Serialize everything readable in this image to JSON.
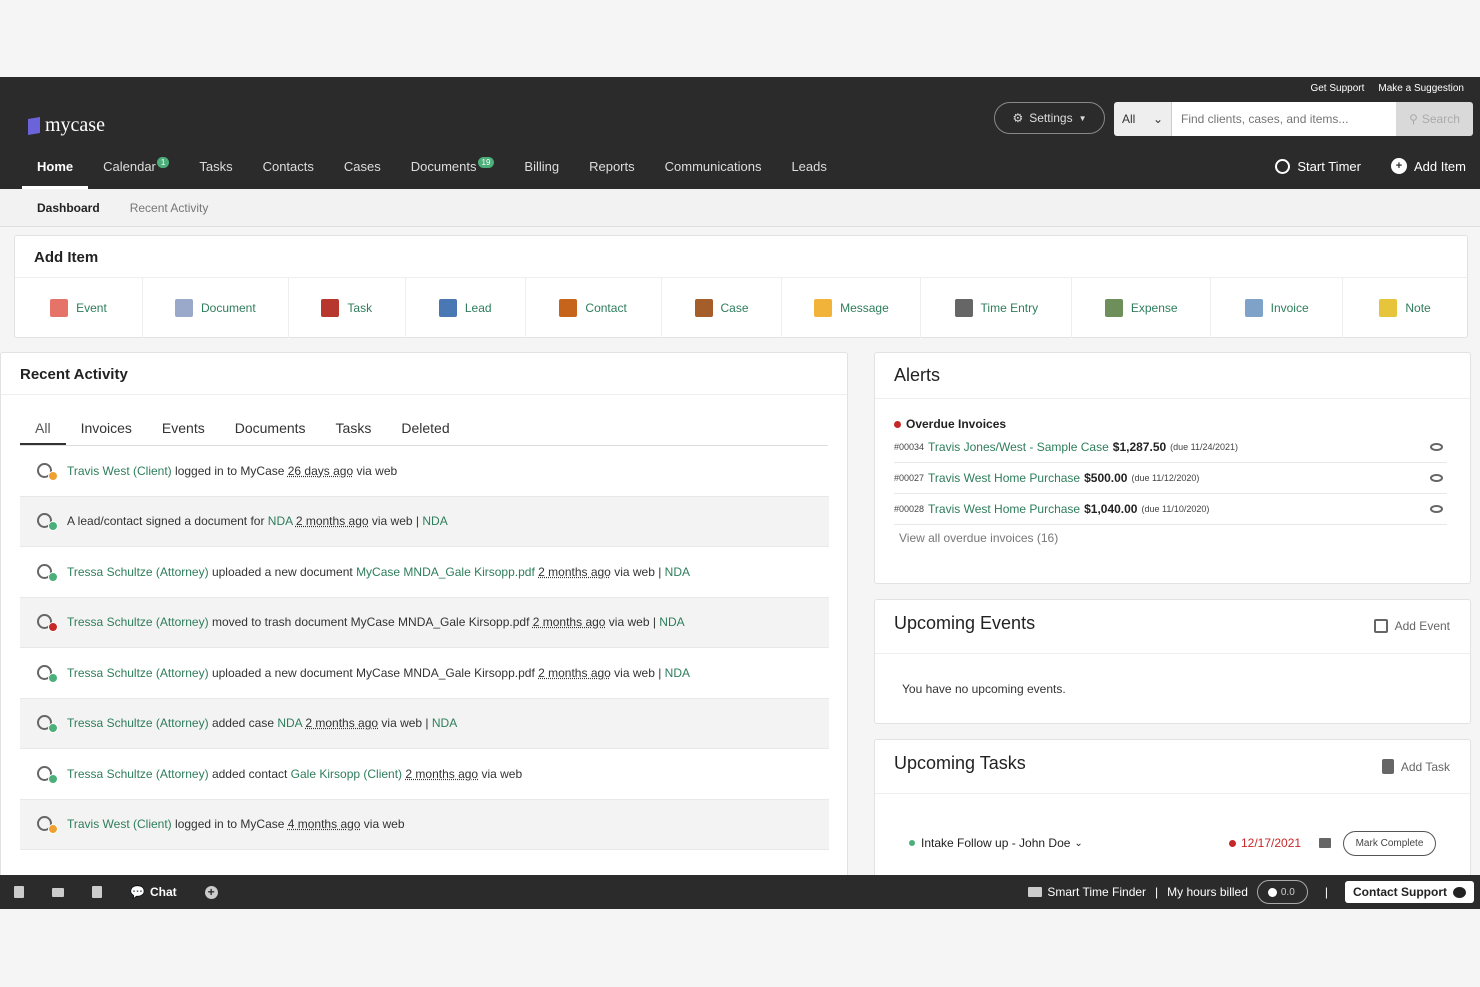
{
  "utility_links": [
    "Get Support",
    "Make a Suggestion"
  ],
  "logo": "mycase",
  "settings_label": "Settings",
  "search": {
    "scope": "All",
    "placeholder": "Find clients, cases, and items...",
    "button": "Search"
  },
  "nav": [
    {
      "label": "Home",
      "badge": ""
    },
    {
      "label": "Calendar",
      "badge": "1"
    },
    {
      "label": "Tasks",
      "badge": ""
    },
    {
      "label": "Contacts",
      "badge": ""
    },
    {
      "label": "Cases",
      "badge": ""
    },
    {
      "label": "Documents",
      "badge": "19"
    },
    {
      "label": "Billing",
      "badge": ""
    },
    {
      "label": "Reports",
      "badge": ""
    },
    {
      "label": "Communications",
      "badge": ""
    },
    {
      "label": "Leads",
      "badge": ""
    }
  ],
  "start_timer": "Start Timer",
  "add_item_top": "Add Item",
  "subnav": [
    "Dashboard",
    "Recent Activity"
  ],
  "add_item": {
    "title": "Add Item",
    "items": [
      "Event",
      "Document",
      "Task",
      "Lead",
      "Contact",
      "Case",
      "Message",
      "Time Entry",
      "Expense",
      "Invoice",
      "Note"
    ],
    "icon_colors": [
      "#e57368",
      "#9aa9c9",
      "#b7362e",
      "#4a78b5",
      "#c7641c",
      "#a55d2a",
      "#f1b33a",
      "#666666",
      "#6e8f5a",
      "#7fa3c8",
      "#e6c43c"
    ]
  },
  "recent": {
    "title": "Recent Activity",
    "tabs": [
      "All",
      "Invoices",
      "Events",
      "Documents",
      "Tasks",
      "Deleted"
    ],
    "rows": [
      {
        "actor": "Travis West (Client)",
        "text": " logged in to MyCase ",
        "time": "26 days ago",
        "suffix": " via web",
        "link": "",
        "badge_color": "#f0a030"
      },
      {
        "actor": "",
        "text": "A lead/contact signed a document for ",
        "obj": "NDA",
        "time": "2 months ago",
        "suffix": " via web | ",
        "link": "NDA",
        "badge_color": "#4caf7a"
      },
      {
        "actor": "Tressa Schultze (Attorney)",
        "text": " uploaded a new document ",
        "obj": "MyCase MNDA_Gale Kirsopp.pdf",
        "time": "2 months ago",
        "suffix": " via web | ",
        "link": "NDA",
        "badge_color": "#4caf7a"
      },
      {
        "actor": "Tressa Schultze (Attorney)",
        "text": " moved to trash document MyCase MNDA_Gale Kirsopp.pdf ",
        "obj": "",
        "time": "2 months ago",
        "suffix": " via web | ",
        "link": "NDA",
        "badge_color": "#c62828"
      },
      {
        "actor": "Tressa Schultze (Attorney)",
        "text": " uploaded a new document MyCase MNDA_Gale Kirsopp.pdf ",
        "obj": "",
        "time": "2 months ago",
        "suffix": " via web | ",
        "link": "NDA",
        "badge_color": "#4caf7a"
      },
      {
        "actor": "Tressa Schultze (Attorney)",
        "text": " added case ",
        "obj": "NDA",
        "time": "2 months ago",
        "suffix": " via web | ",
        "link": "NDA",
        "badge_color": "#4caf7a"
      },
      {
        "actor": "Tressa Schultze (Attorney)",
        "text": " added contact ",
        "obj": "Gale Kirsopp (Client)",
        "time": "2 months ago",
        "suffix": " via web",
        "link": "",
        "badge_color": "#4caf7a"
      },
      {
        "actor": "Travis West (Client)",
        "text": " logged in to MyCase ",
        "obj": "",
        "time": "4 months ago",
        "suffix": " via web",
        "link": "",
        "badge_color": "#f0a030"
      }
    ]
  },
  "alerts": {
    "title": "Alerts",
    "section": "Overdue Invoices",
    "invoices": [
      {
        "num": "#00034",
        "name": "Travis Jones/West - Sample Case",
        "amount": "$1,287.50",
        "due": "(due 11/24/2021)"
      },
      {
        "num": "#00027",
        "name": "Travis West Home Purchase",
        "amount": "$500.00",
        "due": "(due 11/12/2020)"
      },
      {
        "num": "#00028",
        "name": "Travis West Home Purchase",
        "amount": "$1,040.00",
        "due": "(due 11/10/2020)"
      }
    ],
    "view_all": "View all overdue invoices (16)"
  },
  "events": {
    "title": "Upcoming Events",
    "action": "Add Event",
    "empty": "You have no upcoming events."
  },
  "tasks": {
    "title": "Upcoming Tasks",
    "action": "Add Task",
    "task_name": "Intake Follow up - John Doe",
    "due": "12/17/2021",
    "mark_complete": "Mark Complete"
  },
  "bottom": {
    "chat": "Chat",
    "smart_time": "Smart Time Finder",
    "hours_billed": "My hours billed",
    "hours_value": "0.0",
    "contact_support": "Contact Support"
  }
}
